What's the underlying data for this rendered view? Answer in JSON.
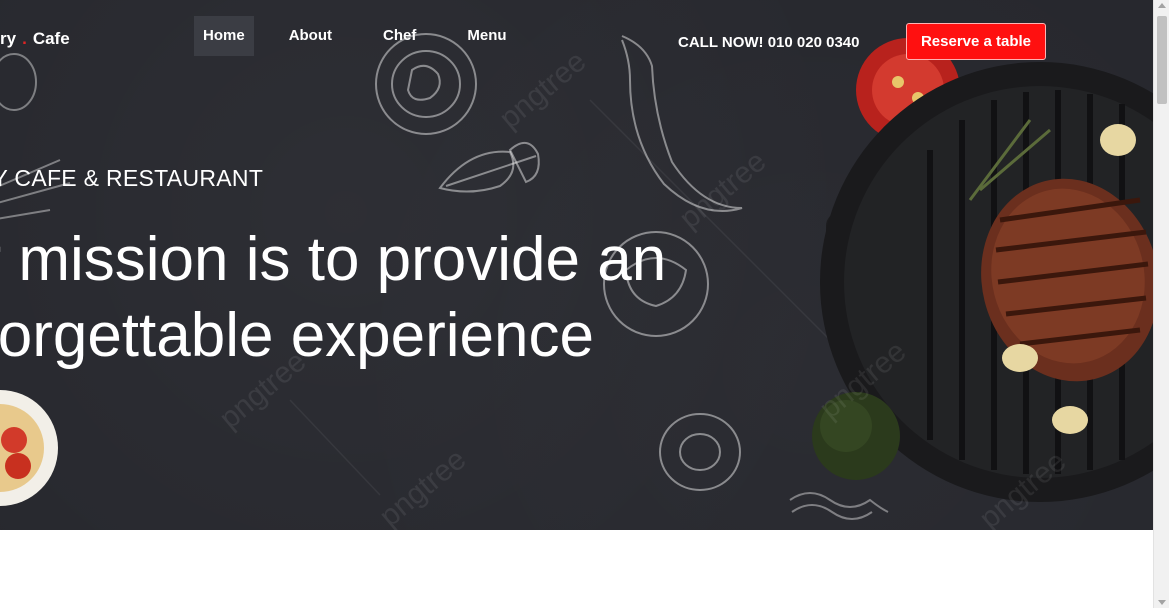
{
  "header": {
    "logo_left": "ry",
    "logo_dot": ".",
    "logo_right": "Cafe",
    "nav": [
      {
        "label": "Home",
        "active": true
      },
      {
        "label": "About"
      },
      {
        "label": "Chef"
      },
      {
        "label": "Menu"
      }
    ],
    "call_text": "CALL NOW! 010 020 0340",
    "reserve_label": "Reserve a table"
  },
  "hero": {
    "subtitle": "RY CAFE & RESTAURANT",
    "headline_line1": "ur mission is to provide an",
    "headline_line2": "nforgettable experience",
    "watermark": "pngtree"
  },
  "colors": {
    "hero_bg": "#27282e",
    "accent": "#ff1010",
    "nav_active_bg": "#3b3d44"
  }
}
